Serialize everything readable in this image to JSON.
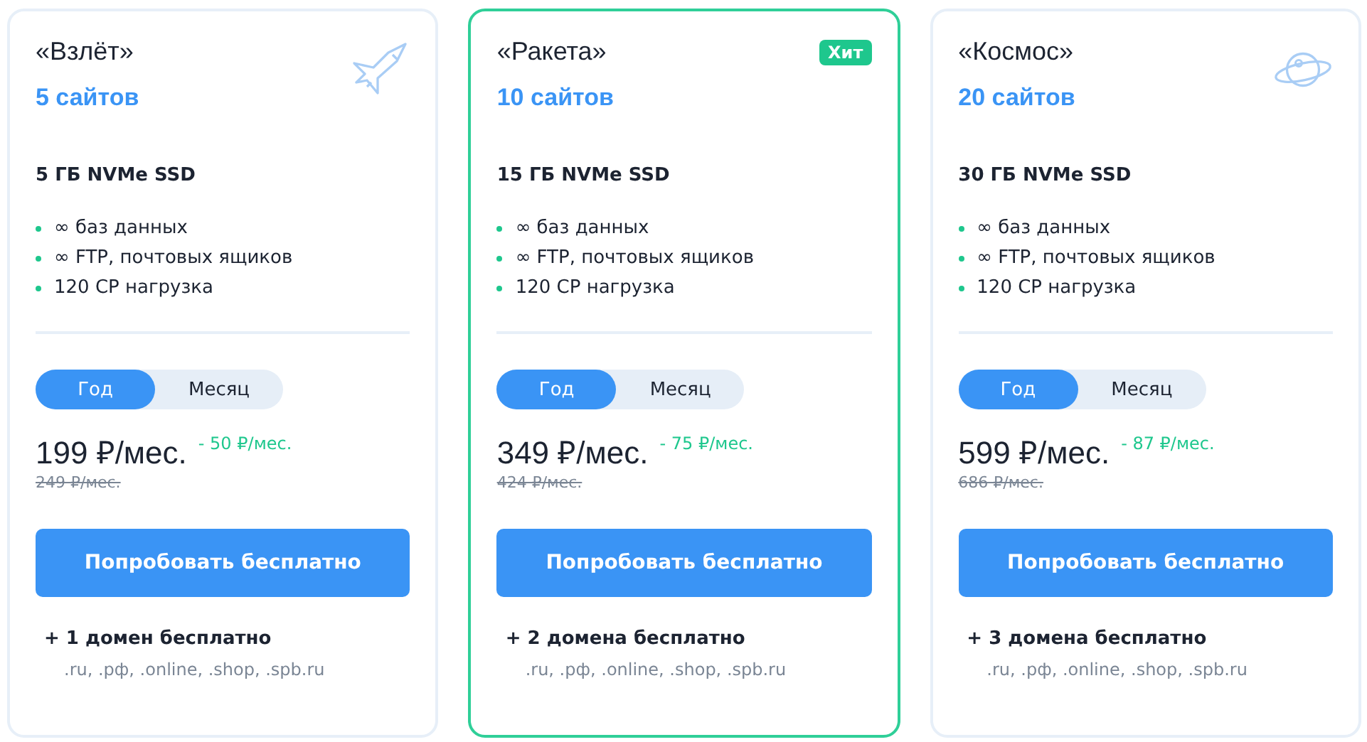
{
  "plans": [
    {
      "name": "«Взлёт»",
      "kind": "plane",
      "featured": false,
      "sites": "5 сайтов",
      "storage": "5 ГБ NVMe SSD",
      "features": [
        "∞ баз данных",
        "∞ FTP, почтовых ящиков",
        "120 CP нагрузка"
      ],
      "periods": [
        {
          "label": "Год",
          "selected": true
        },
        {
          "label": "Месяц",
          "selected": false
        }
      ],
      "price": "199 ₽/мес.",
      "discount": "- 50 ₽/мес.",
      "old_price": "249 ₽/мес.",
      "button": "Попробовать бесплатно",
      "domain_bonus": "+ 1 домен бесплатно",
      "zones": ".ru, .рф, .online, .shop, .spb.ru"
    },
    {
      "name": "«Ракета»",
      "badge": "Хит",
      "featured": true,
      "sites": "10 сайтов",
      "storage": "15 ГБ NVMe SSD",
      "features": [
        "∞ баз данных",
        "∞ FTP, почтовых ящиков",
        "120 CP нагрузка"
      ],
      "periods": [
        {
          "label": "Год",
          "selected": true
        },
        {
          "label": "Месяц",
          "selected": false
        }
      ],
      "price": "349 ₽/мес.",
      "discount": "- 75 ₽/мес.",
      "old_price": "424 ₽/мес.",
      "button": "Попробовать бесплатно",
      "domain_bonus": "+ 2 домена бесплатно",
      "zones": ".ru, .рф, .online, .shop, .spb.ru"
    },
    {
      "name": "«Космос»",
      "kind": "planet",
      "featured": false,
      "sites": "20 сайтов",
      "storage": "30 ГБ NVMe SSD",
      "features": [
        "∞ баз данных",
        "∞ FTP, почтовых ящиков",
        "120 CP нагрузка"
      ],
      "periods": [
        {
          "label": "Год",
          "selected": true
        },
        {
          "label": "Месяц",
          "selected": false
        }
      ],
      "price": "599 ₽/мес.",
      "discount": "- 87 ₽/мес.",
      "old_price": "686 ₽/мес.",
      "button": "Попробовать бесплатно",
      "domain_bonus": "+ 3 домена бесплатно",
      "zones": ".ru, .рф, .online, .shop, .spb.ru"
    }
  ]
}
